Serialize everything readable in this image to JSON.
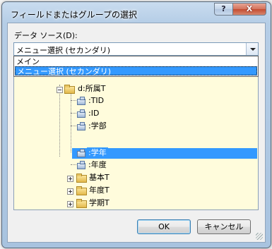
{
  "dialog": {
    "title": "フィールドまたはグループの選択",
    "help_label": "?",
    "close_label": "X"
  },
  "datasource": {
    "label": "データ ソース(D):",
    "value": "メニュー選択 (セカンダリ)",
    "options": [
      "メイン",
      "メニュー選択 (セカンダリ)"
    ],
    "selected_index": 1
  },
  "tree": {
    "group": "d:所属T",
    "fields": [
      ":TID",
      ":ID",
      ":学部",
      ":学年",
      ":年度"
    ],
    "selected_field_index": 3,
    "collapsed_groups": [
      "基本T",
      "年度T",
      "学期T"
    ]
  },
  "buttons": {
    "ok": "OK",
    "cancel": "キャンセル"
  }
}
